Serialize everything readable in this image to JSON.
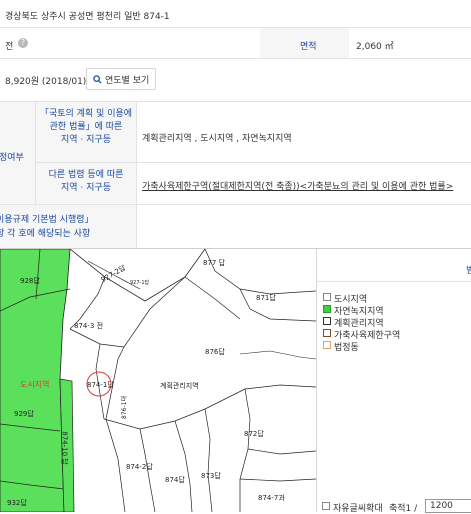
{
  "address": "경상북도 상주시 공성면 평천리 일반 874-1",
  "land": {
    "category": "전",
    "area_label": "면적",
    "area_value": "2,060 ㎡"
  },
  "price": {
    "value": "8,920원 (2018/01)",
    "button_label": "연도별 보기"
  },
  "zoning": {
    "section_label": "정여부",
    "rows": [
      {
        "law": "「국토의 계획 및 이용에 관한 법률」에 따른 지역 · 지구등",
        "law_lines": [
          "「국토의 계획 및 이용에",
          "관한 법률」에 따른",
          "지역 · 지구등"
        ],
        "value": "계획관리지역 , 도시지역 , 자연녹지지역"
      },
      {
        "law": "다른 법령 등에 따른 지역 · 지구등",
        "law_lines": [
          "다른 법령 등에 따른",
          "지역 · 지구등"
        ],
        "value": "가축사육제한구역(절대제한지역(전 축종))<가축분뇨의 관리 및 이용에 관한 법률>"
      }
    ],
    "extra_lines": [
      "이용규제 기본법 시행령」",
      "항 각 호에 해당되는 사항"
    ]
  },
  "map": {
    "parcels": [
      "927-2",
      "927-1",
      "877 답",
      "928",
      "874-3",
      "871",
      "876",
      "874-1",
      "도시지역",
      "929",
      "계획관리지역",
      "876-1",
      "874-10",
      "872",
      "874-2",
      "874",
      "873",
      "932",
      "874-7"
    ],
    "parcel_labels": [
      "927-2답",
      "927-1답",
      "877 답",
      "928답",
      "874-3 전",
      "871답",
      "876답",
      "874-1답",
      "도시지역",
      "929답",
      "계획관리지역",
      "876-1대",
      "874-10 답",
      "872답",
      "874-2답",
      "874답",
      "873답",
      "932답",
      "874-7과"
    ]
  },
  "legend": {
    "title": "범",
    "items": [
      {
        "label": "도시지역",
        "color": "#ffffff"
      },
      {
        "label": "자연녹지지역",
        "color": "#44cc44"
      },
      {
        "label": "계획관리지역",
        "color": "#ffffff"
      },
      {
        "label": "가축사육제한구역",
        "color": "#ffffff"
      },
      {
        "label": "법정동",
        "color": "#ffffff"
      }
    ],
    "bottom_checkbox_label": "자유글씨확대",
    "scale_label": "축적1 /",
    "scale_value": "1200"
  },
  "colors": {
    "green": "#5be05b",
    "parcel_line": "#333333",
    "highlight": "#e23a3a"
  }
}
